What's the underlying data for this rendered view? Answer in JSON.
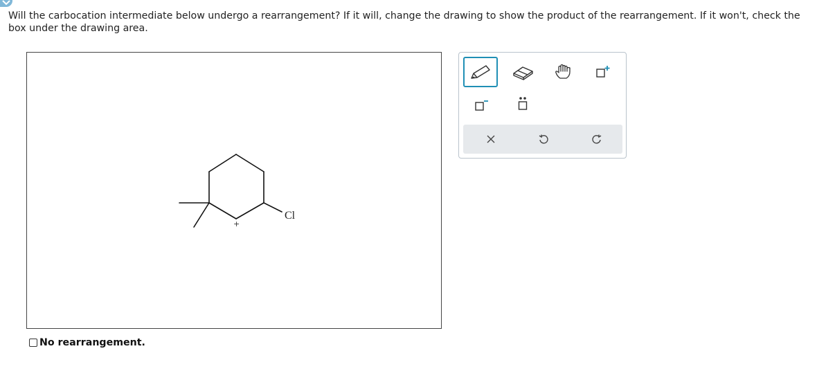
{
  "question": {
    "text": "Will the carbocation intermediate below undergo a rearrangement? If it will, change the drawing to show the product of the rearrangement. If it won't, check the box under the drawing area."
  },
  "molecule": {
    "plus_charge": "+",
    "chlorine_label": "Cl"
  },
  "toolbar": {
    "tools": [
      {
        "name": "pencil-tool",
        "icon": "pencil-icon",
        "active": true
      },
      {
        "name": "eraser-tool",
        "icon": "eraser-icon",
        "active": false
      },
      {
        "name": "hand-tool",
        "icon": "hand-icon",
        "active": false
      },
      {
        "name": "add-positive-charge-tool",
        "icon": "positive-charge-icon",
        "active": false
      },
      {
        "name": "add-negative-charge-tool",
        "icon": "negative-charge-icon",
        "active": false
      },
      {
        "name": "add-lone-pair-tool",
        "icon": "lone-pair-icon",
        "active": false
      }
    ],
    "actions": [
      {
        "name": "clear-button",
        "icon": "close-icon"
      },
      {
        "name": "undo-button",
        "icon": "undo-icon"
      },
      {
        "name": "redo-button",
        "icon": "redo-icon"
      }
    ],
    "accent_color": "#1f8fb5"
  },
  "answer": {
    "checkbox_label": "No rearrangement.",
    "checked": false
  }
}
